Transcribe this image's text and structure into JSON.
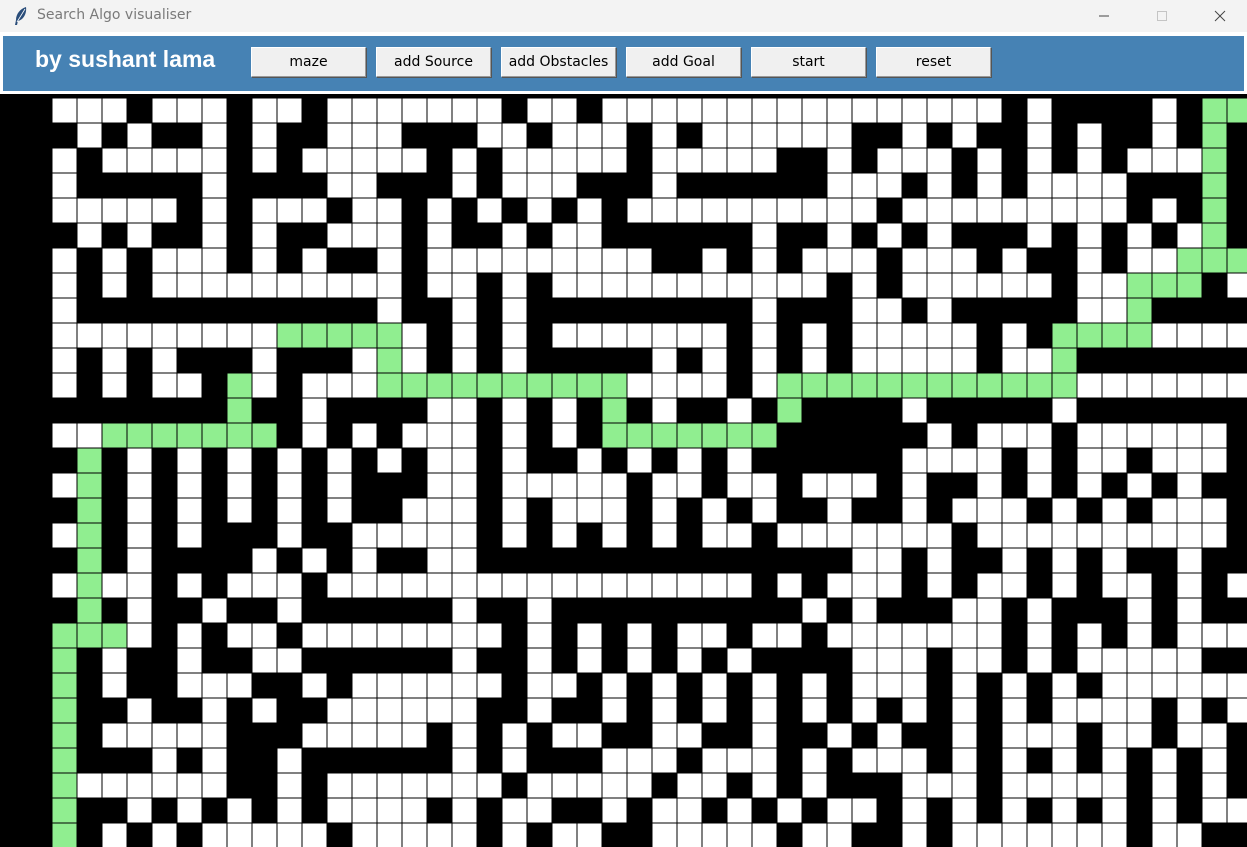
{
  "window": {
    "title": "Search Algo visualiser",
    "icon": "feather-icon"
  },
  "toolbar": {
    "author": "by sushant lama",
    "buttons": [
      "maze",
      "add Source",
      "add Obstacles",
      "add Goal",
      "start",
      "reset"
    ]
  },
  "colors": {
    "toolbar": "#4682b4",
    "wall": "#000000",
    "open": "#ffffff",
    "path": "#90ee90"
  },
  "maze": {
    "cols": 50,
    "rows": 30,
    "note_legend": "0 = wall, 1 = open cell, 2 = path cell",
    "grid": [
      "01110111011011111110110111111111111111101000010222",
      "00101001010011100011011101011111100101001010010200",
      "01011111010111110101111101111100101110101010111202",
      "01000001000011000101110001000000111010101111000200",
      "01111101011101101010101011111111110111111111010201",
      "00101001010011101001011000000100101010001010101201",
      "01010111010100101111111110010101110111010010112221",
      "01010111111111101101011111111111010111111011222011",
      "01000000000000100101000000000100011010000011200001",
      "01111111112222210101011111110101011111010222211110",
      "01010100010001210101000001010101011111011200000001",
      "01010110210111222222222211110122222222222211111110",
      "00000000200100001101010201001020000100000100000001",
      "01122222220101011101010222222200000010111011111101",
      "00201010101010101101001010101000000111101011011101",
      "01201010101010001101111101101101110100101010101001",
      "00201010101010011101011101010100100101110101011101",
      "01201010001001111101010101011011111110111111111101",
      "00201000010101001100000000000000011010010101001000",
      "01211010111011111111111111111010111010110101101011",
      "00201001001000000100100000000001010001101000101000",
      "02221010110111111110101010110110111111101010101110",
      "02010010011000000100101010101000011101101011111001",
      "02010011100101111110110101010101011101010101111111",
      "02001001010011111100100101010101010101010111101010",
      "02011111000111110101011001100100101001011101101101",
      "02000101001000000101000111011101011101010101010101",
      "02111111001011111110111110110101000111011111010101",
      "02001010101011110101100101101010110101010101010111",
      "02010101111101111101011001111101100101111111011001"
    ]
  }
}
